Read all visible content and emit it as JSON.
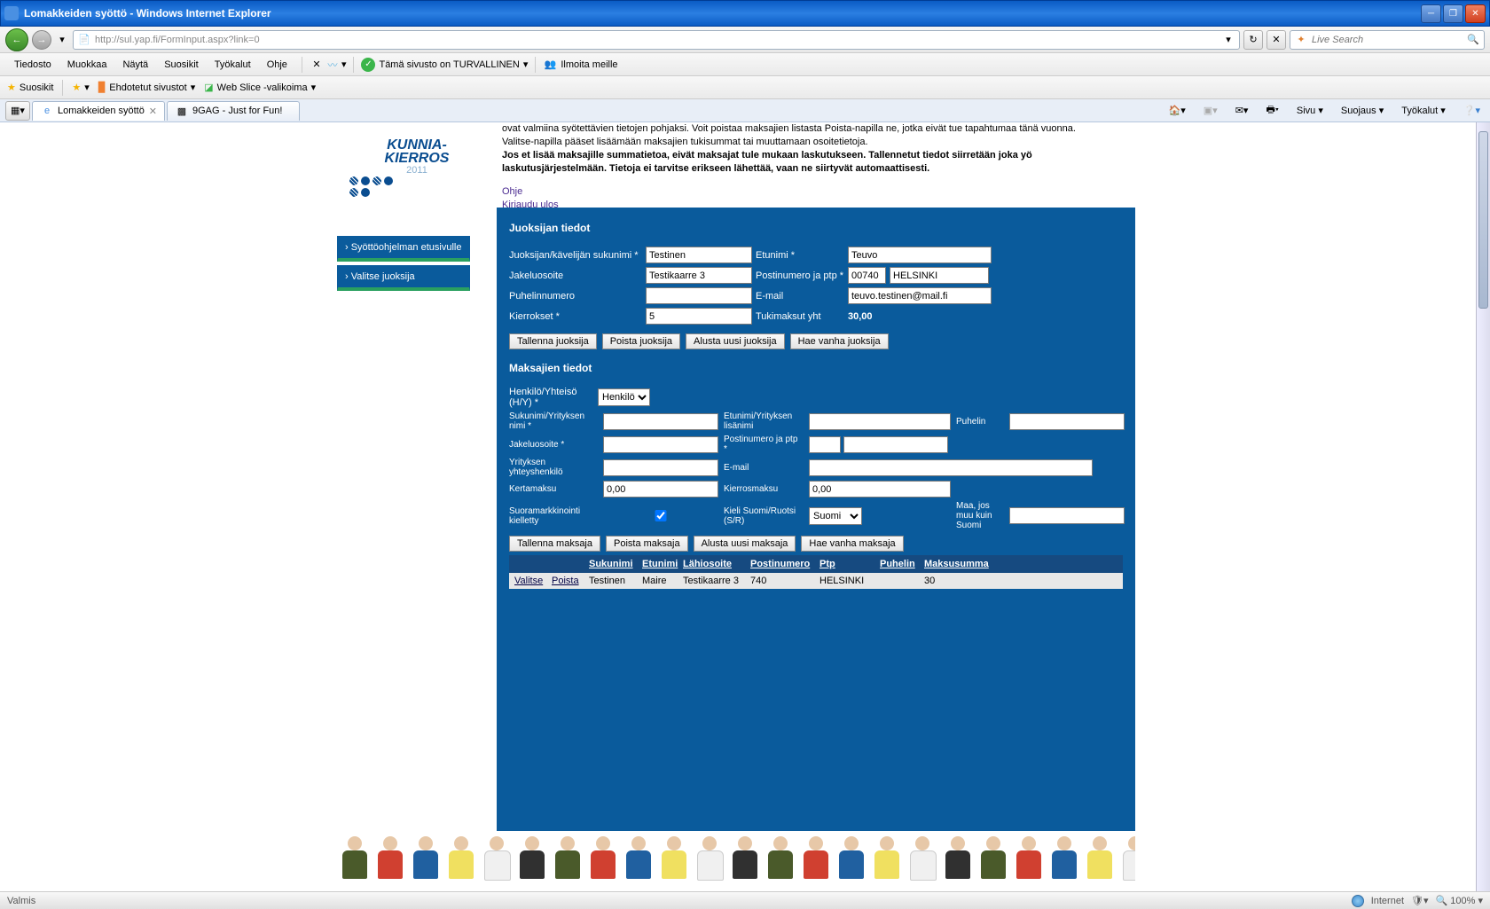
{
  "window": {
    "title": "Lomakkeiden syöttö - Windows Internet Explorer",
    "url": "http://sul.yap.fi/FormInput.aspx?link=0",
    "search_placeholder": "Live Search"
  },
  "menu": {
    "items": [
      "Tiedosto",
      "Muokkaa",
      "Näytä",
      "Suosikit",
      "Työkalut",
      "Ohje"
    ],
    "security_label": "Tämä sivusto on TURVALLINEN",
    "report_label": "Ilmoita meille"
  },
  "favbar": {
    "fav_label": "Suosikit",
    "suggested": "Ehdotetut sivustot",
    "webslice": "Web Slice -valikoima"
  },
  "tabs": [
    {
      "label": "Lomakkeiden syöttö",
      "active": true
    },
    {
      "label": "9GAG - Just for Fun!",
      "active": false
    }
  ],
  "right_menu": [
    "Sivu",
    "Suojaus",
    "Työkalut"
  ],
  "logo": {
    "line1": "KUNNIA-",
    "line2": "KIERROS",
    "year": "2011"
  },
  "intro": {
    "p1": "ovat valmiina syötettävien tietojen pohjaksi. Voit poistaa maksajien listasta Poista-napilla ne, jotka eivät tue tapahtumaa tänä vuonna.",
    "p2": "Valitse-napilla pääset lisäämään maksajien tukisummat tai muuttamaan osoitetietoja.",
    "bold": "Jos et lisää maksajille summatietoa, eivät maksajat tule mukaan laskutukseen. Tallennetut tiedot siirretään joka yö laskutusjärjestelmään. Tietoja ei tarvitse erikseen lähettää, vaan ne siirtyvät automaattisesti.",
    "link1": "Ohje",
    "link2": "Kirjaudu ulos"
  },
  "sidebar": {
    "item1": "› Syöttöohjelman etusivulle",
    "item2": "› Valitse juoksija"
  },
  "runner": {
    "title": "Juoksijan tiedot",
    "labels": {
      "lastname": "Juoksijan/kävelijän sukunimi *",
      "firstname": "Etunimi *",
      "address": "Jakeluosoite",
      "zip": "Postinumero ja ptp *",
      "phone": "Puhelinnumero",
      "email": "E-mail",
      "laps": "Kierrokset *",
      "total": "Tukimaksut yht"
    },
    "values": {
      "lastname": "Testinen",
      "firstname": "Teuvo",
      "address": "Testikaarre 3",
      "zip": "00740",
      "city": "HELSINKI",
      "phone": "",
      "email": "teuvo.testinen@mail.fi",
      "laps": "5",
      "total": "30,00"
    },
    "buttons": {
      "save": "Tallenna juoksija",
      "delete": "Poista juoksija",
      "init": "Alusta uusi juoksija",
      "fetch": "Hae vanha juoksija"
    }
  },
  "payer": {
    "title": "Maksajien tiedot",
    "labels": {
      "type": "Henkilö/Yhteisö (H/Y) *",
      "lastname": "Sukunimi/Yrityksen nimi *",
      "firstname": "Etunimi/Yrityksen lisänimi",
      "phone": "Puhelin",
      "address": "Jakeluosoite *",
      "zip": "Postinumero ja ptp *",
      "contact": "Yrityksen yhteyshenkilö",
      "email": "E-mail",
      "onetime": "Kertamaksu",
      "perlap": "Kierrosmaksu",
      "marketing": "Suoramarkkinointi kielletty",
      "lang": "Kieli Suomi/Ruotsi (S/R)",
      "country": "Maa, jos muu kuin Suomi"
    },
    "values": {
      "type": "Henkilö",
      "lastname": "",
      "firstname": "",
      "phone": "",
      "address": "",
      "zip": "",
      "city": "",
      "contact": "",
      "email": "",
      "onetime": "0,00",
      "perlap": "0,00",
      "lang": "Suomi",
      "country": "",
      "marketing_checked": true
    },
    "buttons": {
      "save": "Tallenna maksaja",
      "delete": "Poista maksaja",
      "init": "Alusta uusi maksaja",
      "fetch": "Hae vanha maksaja"
    }
  },
  "table": {
    "headers": {
      "lastname": "Sukunimi",
      "firstname": "Etunimi",
      "address": "Lähiosoite",
      "zip": "Postinumero",
      "city": "Ptp",
      "phone": "Puhelin",
      "sum": "Maksusumma"
    },
    "row": {
      "select": "Valitse",
      "delete": "Poista",
      "lastname": "Testinen",
      "firstname": "Maire",
      "address": "Testikaarre 3",
      "zip": "740",
      "city": "HELSINKI",
      "phone": "",
      "sum": "30"
    }
  },
  "status": {
    "done": "Valmis",
    "zone": "Internet",
    "zoom": "100%"
  }
}
